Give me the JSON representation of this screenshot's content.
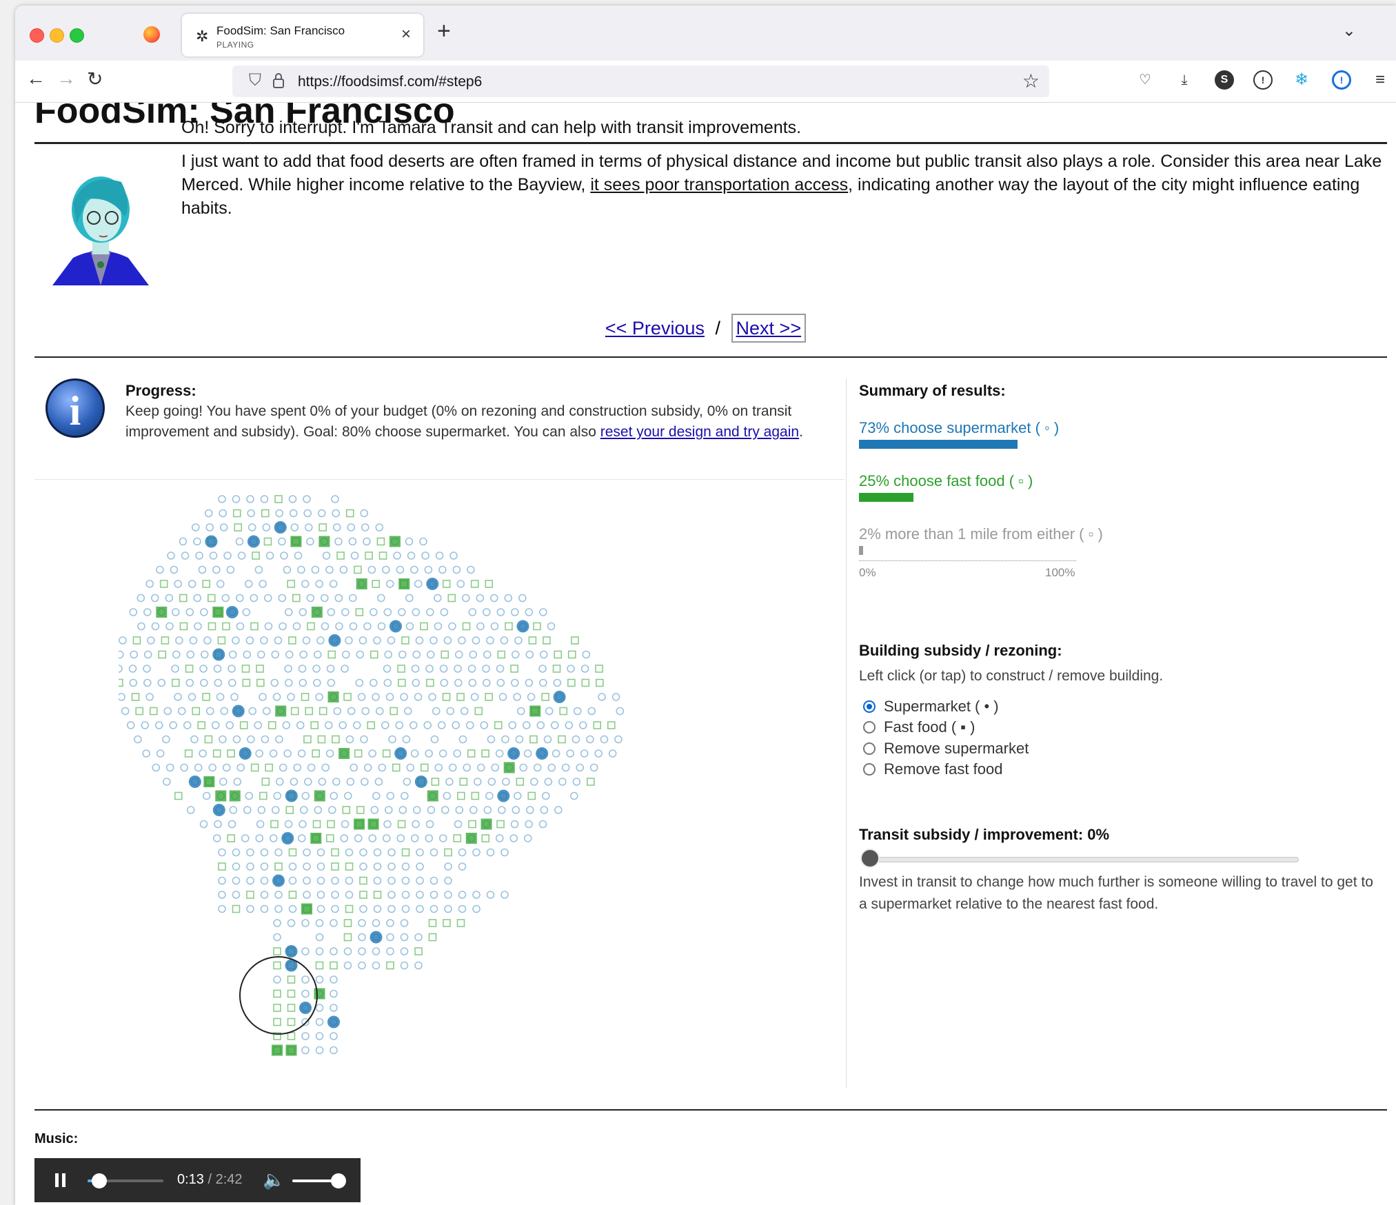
{
  "browser": {
    "tab_title": "FoodSim: San Francisco",
    "tab_status": "PLAYING",
    "url": "https://foodsimsf.com/#step6"
  },
  "page": {
    "title": "FoodSim: San Francisco",
    "dialog": {
      "line1": "Oh! Sorry to interrupt. I'm Tamara Transit and can help with transit improvements.",
      "line2_before": "I just want to add that food deserts are often framed in terms of physical distance and income but public transit also plays a role. Consider this area near Lake Merced. While higher income relative to the Bayview, ",
      "line2_link": "it sees poor transportation access",
      "line2_after": ", indicating another way the layout of the city might influence eating habits."
    },
    "nav": {
      "previous": "<< Previous",
      "separator": "/",
      "next": "Next >>"
    },
    "progress": {
      "heading": "Progress:",
      "text": "Keep going! You have spent 0% of your budget (0% on rezoning and construction subsidy, 0% on transit improvement and subsidy). Goal: 80% choose supermarket. You can also ",
      "link": "reset your design and try again",
      "after": "."
    },
    "summary": {
      "heading": "Summary of results:",
      "results": [
        {
          "label": "73% choose supermarket ( ◦ )",
          "value": 73,
          "color": "#1f77b4"
        },
        {
          "label": "25% choose fast food ( ▫ )",
          "value": 25,
          "color": "#2ca02c"
        },
        {
          "label": "2% more than 1 mile from either ( ▫ )",
          "value": 2,
          "color": "#999999"
        }
      ],
      "axis_min": "0%",
      "axis_max": "100%"
    },
    "building": {
      "heading": "Building subsidy / rezoning:",
      "help": "Left click (or tap) to construct / remove building.",
      "options": [
        "Supermarket ( • )",
        "Fast food ( ▪ )",
        "Remove supermarket",
        "Remove fast food"
      ],
      "selected": "Supermarket ( • )"
    },
    "transit": {
      "heading": "Transit subsidy / improvement: 0%",
      "value": 0,
      "text": "Invest in transit to change how much further is someone willing to travel to get to a supermarket relative to the nearest fast food."
    },
    "music": {
      "label": "Music:",
      "current": "0:13",
      "duration": " / 2:42",
      "progress": 0.08,
      "volume": 1.0
    },
    "colors": {
      "supermarket": "#1f77b4",
      "fastfood": "#2ca02c",
      "none": "#999999",
      "link": "#1a0dab"
    },
    "icons": [
      "shield-icon",
      "lock-icon",
      "star-icon",
      "pocket-icon",
      "download-icon",
      "info-icon",
      "firefox-icon"
    ]
  }
}
